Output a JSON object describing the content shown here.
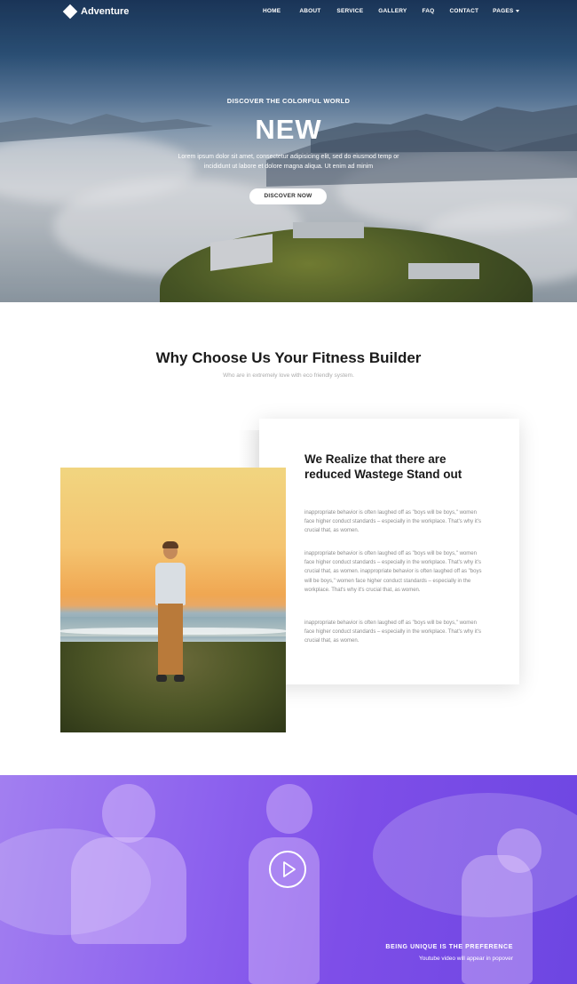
{
  "brand": {
    "name": "Adventure"
  },
  "nav": {
    "items": [
      "HOME",
      "ABOUT",
      "SERVICE",
      "GALLERY",
      "FAQ",
      "CONTACT",
      "PAGES"
    ]
  },
  "hero": {
    "subtitle": "DISCOVER THE COLORFUL WORLD",
    "title": "NEW",
    "description": "Lorem ipsum dolor sit amet, consectetur adipisicing elit, sed do eiusmod temp or incididunt ut labore et dolore magna aliqua. Ut enim ad minim",
    "button": "DISCOVER NOW"
  },
  "why": {
    "title": "Why Choose Us Your Fitness Builder",
    "subtitle": "Who are in extremely love with eco friendly system.",
    "card_title": "We Realize that there are reduced Wastege Stand out",
    "paragraphs": [
      "inappropriate behavior is often laughed off as \"boys will be boys,\" women face higher conduct standards – especially in the workplace. That's why it's crucial that, as women.",
      "inappropriate behavior is often laughed off as \"boys will be boys,\" women face higher conduct standards – especially in the workplace. That's why it's crucial that, as women. inappropriate behavior is often laughed off as \"boys will be boys,\" women face higher conduct standards – especially in the workplace. That's why it's crucial that, as women.",
      "inappropriate behavior is often laughed off as \"boys will be boys,\" women face higher conduct standards – especially in the workplace. That's why it's crucial that, as women."
    ]
  },
  "video": {
    "title": "BEING UNIQUE IS THE PREFERENCE",
    "subtitle": "Youtube video will appear in popover"
  }
}
